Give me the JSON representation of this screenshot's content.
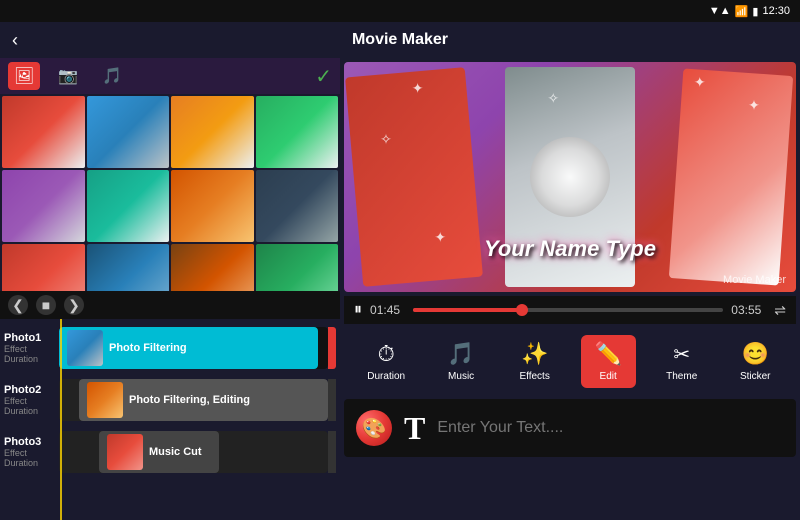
{
  "statusBar": {
    "signal": "▼▲",
    "wifi": "WiFi",
    "battery": "🔋",
    "time": "12:30"
  },
  "titleBar": {
    "backLabel": "‹",
    "title": "Movie Maker"
  },
  "mediaTabs": {
    "photo": "🖼",
    "camera": "📷",
    "music": "🎵",
    "check": "✓"
  },
  "photos": [
    "p1",
    "p2",
    "p3",
    "p4",
    "p5",
    "p6",
    "p7",
    "p8",
    "p9",
    "p10",
    "p11",
    "p12"
  ],
  "timelineControls": {
    "prev": "❮",
    "stop": "■",
    "next": "❯"
  },
  "timeline": {
    "rows": [
      {
        "name": "Photo1",
        "effect": "Effect",
        "duration": "Duration",
        "track": "Photo Filtering",
        "color": "teal"
      },
      {
        "name": "Photo2",
        "effect": "Effect",
        "duration": "Duration",
        "track": "Photo Filtering, Editing",
        "color": "dark"
      },
      {
        "name": "Photo3",
        "effect": "Effect",
        "duration": "Duration",
        "track": "Music Cut",
        "color": "dark"
      }
    ]
  },
  "videoPreview": {
    "title": "Your Name Type",
    "watermark": "Movie Maker"
  },
  "progressBar": {
    "playIcon": "⏸",
    "currentTime": "01:45",
    "totalTime": "03:55",
    "shuffleIcon": "⇌",
    "progressPercent": 35
  },
  "editToolbar": {
    "tools": [
      {
        "id": "duration",
        "icon": "⏱",
        "label": "Duration",
        "active": false
      },
      {
        "id": "music",
        "icon": "🎵",
        "label": "Music",
        "active": false
      },
      {
        "id": "effects",
        "icon": "✨",
        "label": "Effects",
        "active": false
      },
      {
        "id": "edit",
        "icon": "✏️",
        "label": "Edit",
        "active": true
      },
      {
        "id": "theme",
        "icon": "✂",
        "label": "Theme",
        "active": false
      },
      {
        "id": "sticker",
        "icon": "😊",
        "label": "Sticker",
        "active": false
      }
    ]
  },
  "textInput": {
    "colorPickerIcon": "🎨",
    "textIcon": "T",
    "placeholder": "Enter Your Text...."
  }
}
